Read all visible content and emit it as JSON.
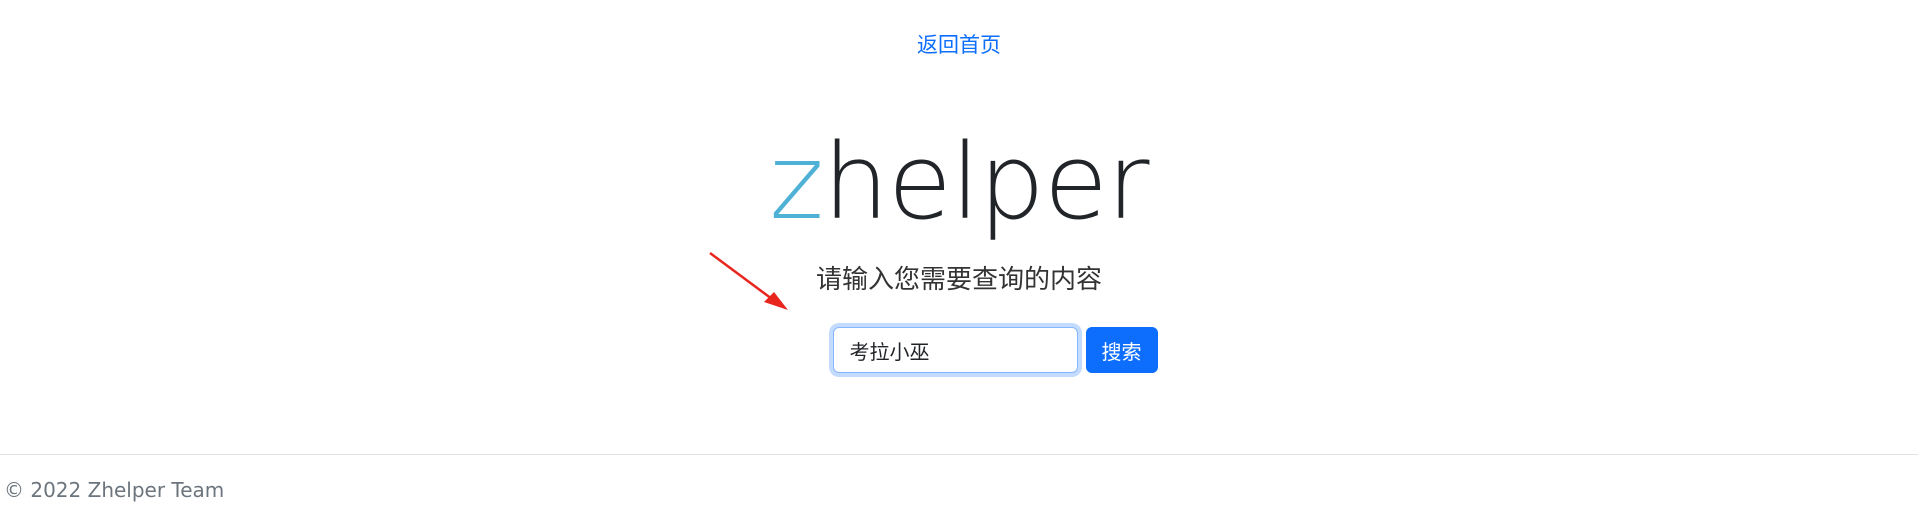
{
  "nav": {
    "back_home": "返回首页"
  },
  "logo": {
    "z": "z",
    "rest": "helper"
  },
  "search": {
    "prompt": "请输入您需要查询的内容",
    "value": "考拉小巫",
    "button_label": "搜索"
  },
  "annotation": {
    "arrow_color": "#e8261e",
    "icon": "arrow-icon"
  },
  "footer": {
    "text": "© 2022 Zhelper Team"
  },
  "colors": {
    "link": "#0d6efd",
    "logo_z": "#4fb1d6",
    "button": "#0d6efd"
  }
}
